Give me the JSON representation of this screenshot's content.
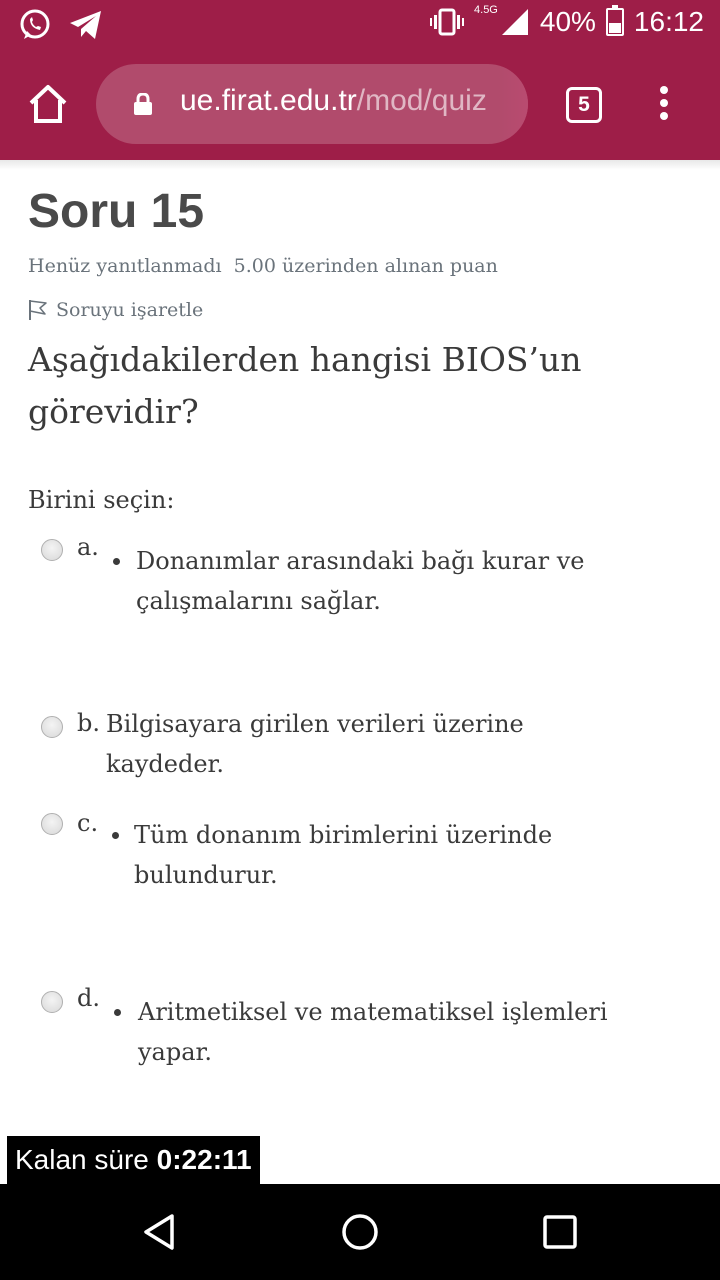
{
  "status_bar": {
    "network": "4.5G",
    "battery": "40%",
    "time": "16:12",
    "icons": [
      "whatsapp-icon",
      "telegram-icon",
      "vibrate-icon",
      "signal-icon",
      "battery-icon"
    ]
  },
  "browser": {
    "url_host": "ue.firat.edu.tr",
    "url_path": "/mod/quiz",
    "tab_count": "5",
    "theme_color": "#9e1e48"
  },
  "question": {
    "number_label": "Soru 15",
    "state": "Henüz yanıtlanmadı",
    "grade": "5.00 üzerinden alınan puan",
    "flag_label": "Soruyu işaretle",
    "text": "Aşağıdakilerden hangisi BIOS’un görevidir?",
    "prompt": "Birini seçin:",
    "options": [
      {
        "letter": "a.",
        "line1": "Donanımlar arasındaki bağı kurar ve",
        "line2": "çalışmalarını sağlar."
      },
      {
        "letter": "b.",
        "line1": "Bilgisayara girilen verileri üzerine",
        "line2": "kaydeder."
      },
      {
        "letter": "c.",
        "line1": "Tüm donanım birimlerini üzerinde",
        "line2": "bulundurur."
      },
      {
        "letter": "d.",
        "line1": "Aritmetiksel ve matematiksel işlemleri",
        "line2": "yapar."
      }
    ]
  },
  "timer": {
    "label": "Kalan süre",
    "value": "0:22:11"
  }
}
